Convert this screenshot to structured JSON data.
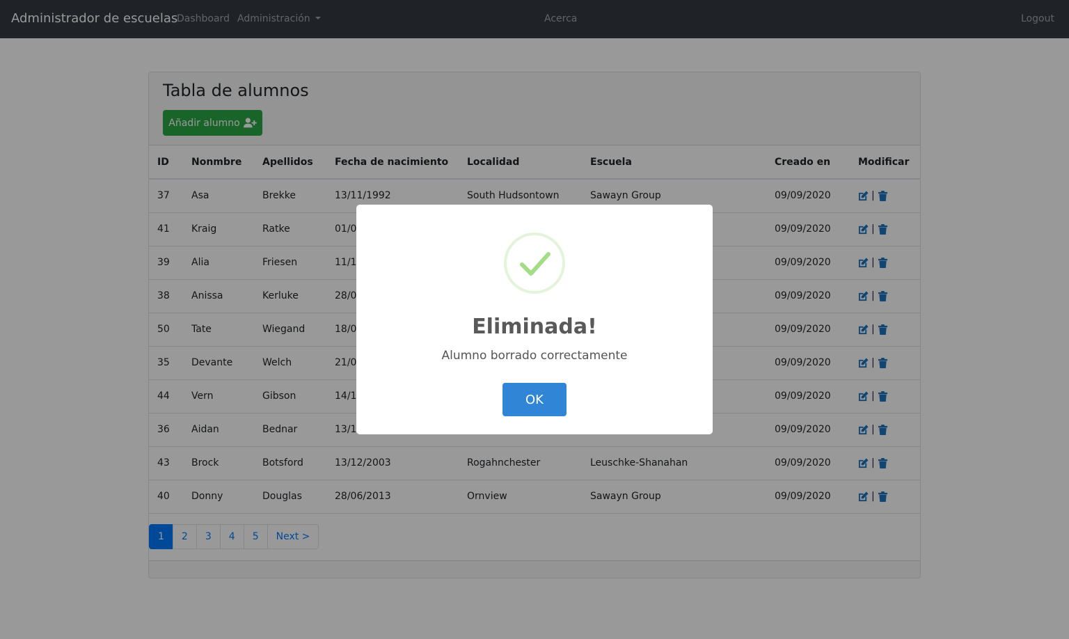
{
  "navbar": {
    "brand": "Administrador de escuelas",
    "links": {
      "dashboard": "Dashboard",
      "admin": "Administración",
      "about": "Acerca",
      "logout": "Logout"
    }
  },
  "card": {
    "title": "Tabla de alumnos",
    "add_button": "Añadir alumno"
  },
  "table": {
    "headers": [
      "ID",
      "Nonmbre",
      "Apellidos",
      "Fecha de nacimiento",
      "Localidad",
      "Escuela",
      "Creado en",
      "Modificar"
    ],
    "rows": [
      {
        "id": "37",
        "nombre": "Asa",
        "apellidos": "Brekke",
        "fecha": "13/11/1992",
        "localidad": "South Hudsontown",
        "escuela": "Sawayn Group",
        "creado": "09/09/2020"
      },
      {
        "id": "41",
        "nombre": "Kraig",
        "apellidos": "Ratke",
        "fecha": "01/0",
        "localidad": "",
        "escuela": "",
        "creado": "09/09/2020"
      },
      {
        "id": "39",
        "nombre": "Alia",
        "apellidos": "Friesen",
        "fecha": "11/1",
        "localidad": "",
        "escuela": "",
        "creado": "09/09/2020"
      },
      {
        "id": "38",
        "nombre": "Anissa",
        "apellidos": "Kerluke",
        "fecha": "28/0",
        "localidad": "",
        "escuela": "",
        "creado": "09/09/2020"
      },
      {
        "id": "50",
        "nombre": "Tate",
        "apellidos": "Wiegand",
        "fecha": "18/0",
        "localidad": "",
        "escuela": "",
        "creado": "09/09/2020"
      },
      {
        "id": "35",
        "nombre": "Devante",
        "apellidos": "Welch",
        "fecha": "21/0",
        "localidad": "",
        "escuela": "",
        "creado": "09/09/2020"
      },
      {
        "id": "44",
        "nombre": "Vern",
        "apellidos": "Gibson",
        "fecha": "14/1",
        "localidad": "",
        "escuela": "ney",
        "creado": "09/09/2020"
      },
      {
        "id": "36",
        "nombre": "Aidan",
        "apellidos": "Bednar",
        "fecha": "13/1",
        "localidad": "",
        "escuela": "",
        "creado": "09/09/2020"
      },
      {
        "id": "43",
        "nombre": "Brock",
        "apellidos": "Botsford",
        "fecha": "13/12/2003",
        "localidad": "Rogahnchester",
        "escuela": "Leuschke-Shanahan",
        "creado": "09/09/2020"
      },
      {
        "id": "40",
        "nombre": "Donny",
        "apellidos": "Douglas",
        "fecha": "28/06/2013",
        "localidad": "Ornview",
        "escuela": "Sawayn Group",
        "creado": "09/09/2020"
      }
    ],
    "action_separator": "|"
  },
  "pagination": {
    "pages": [
      "1",
      "2",
      "3",
      "4",
      "5"
    ],
    "next": "Next >",
    "active": "1"
  },
  "modal": {
    "title": "Eliminada!",
    "text": "Alumno borrado correctamente",
    "ok": "OK",
    "icon": "success-check-icon"
  },
  "colors": {
    "navbar": "#343a40",
    "add_button": "#28a745",
    "link": "#007bff",
    "icon": "#1e73be",
    "ok_button": "#3085d6",
    "check": "#a5dc86"
  }
}
